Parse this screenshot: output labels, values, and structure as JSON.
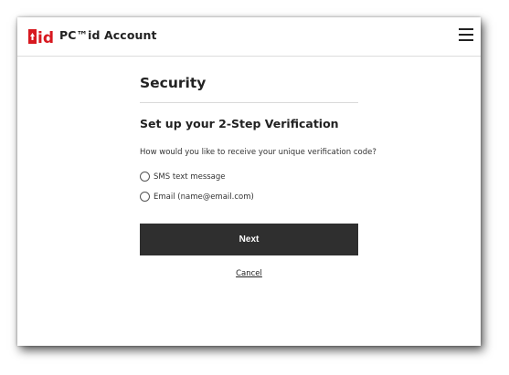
{
  "header": {
    "logo_icon": "pc-id-logo",
    "logo_text": "id",
    "app_title": "PC™id Account",
    "menu_icon": "hamburger-menu-icon",
    "brand_color": "#d71920"
  },
  "main": {
    "page_title": "Security",
    "section_title": "Set up your 2-Step Verification",
    "question": "How would you like to receive your unique verification code?",
    "options": [
      {
        "label": "SMS text message",
        "selected": false
      },
      {
        "label": "Email (name@email.com)",
        "selected": false
      }
    ],
    "next_label": "Next",
    "cancel_label": "Cancel",
    "button_color": "#2f2f2f"
  }
}
